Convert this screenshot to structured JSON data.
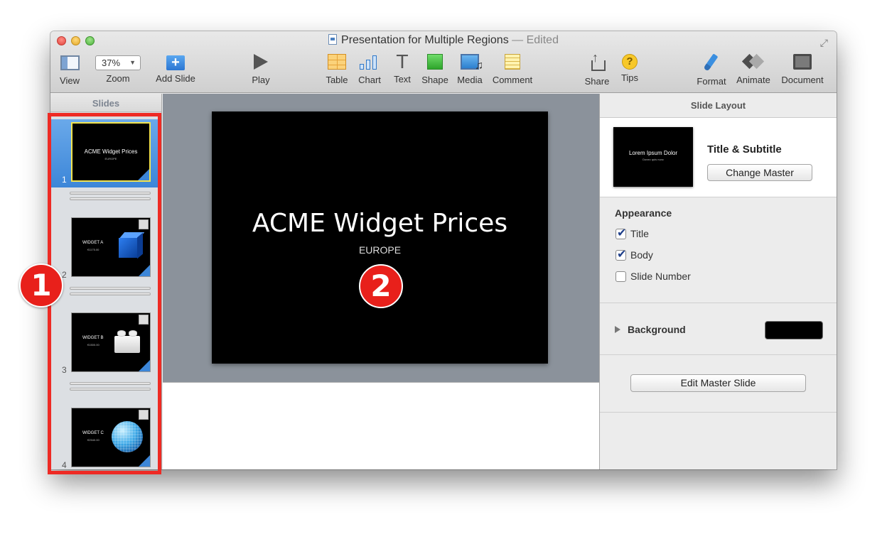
{
  "window": {
    "title": "Presentation for Multiple Regions",
    "edited_suffix": "— Edited"
  },
  "toolbar": {
    "view_label": "View",
    "zoom_value": "37%",
    "zoom_label": "Zoom",
    "add_slide_label": "Add Slide",
    "play_label": "Play",
    "table_label": "Table",
    "chart_label": "Chart",
    "text_label": "Text",
    "shape_label": "Shape",
    "media_label": "Media",
    "comment_label": "Comment",
    "share_label": "Share",
    "tips_label": "Tips",
    "format_label": "Format",
    "animate_label": "Animate",
    "document_label": "Document"
  },
  "navigator": {
    "header": "Slides",
    "slides": [
      {
        "num": "1",
        "title": "ACME Widget Prices",
        "subtitle": "EUROPE"
      },
      {
        "num": "2",
        "title": "WIDGET A",
        "subtitle": "€1175.00"
      },
      {
        "num": "3",
        "title": "WIDGET B",
        "subtitle": "€1500.00"
      },
      {
        "num": "4",
        "title": "WIDGET C",
        "subtitle": "€2540.00"
      }
    ]
  },
  "slide": {
    "title": "ACME Widget Prices",
    "subtitle": "EUROPE"
  },
  "inspector": {
    "header": "Slide Layout",
    "master_thumb_title": "Lorem Ipsum Dolor",
    "master_thumb_sub": "Donec quis nunc",
    "layout_name": "Title & Subtitle",
    "change_master_label": "Change Master",
    "appearance_title": "Appearance",
    "title_checkbox": "Title",
    "body_checkbox": "Body",
    "slide_number_checkbox": "Slide Number",
    "background_label": "Background",
    "background_color": "#000000",
    "edit_master_label": "Edit Master Slide"
  },
  "callouts": {
    "one": "1",
    "two": "2",
    "color": "#e8201b"
  }
}
